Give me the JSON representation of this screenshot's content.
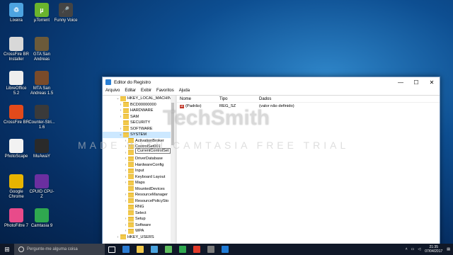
{
  "desktop": {
    "icons": [
      {
        "label": "Lixeira",
        "color": "#4da3e0",
        "glyph": "♲"
      },
      {
        "label": "µTorrent",
        "color": "#6ab42d",
        "glyph": "µ"
      },
      {
        "label": "Funny Voice",
        "color": "#444444",
        "glyph": "🎤"
      },
      {
        "label": "CrossFire BR Installer",
        "color": "#d8d8d8",
        "glyph": ""
      },
      {
        "label": "GTA San Andreas",
        "color": "#6b5a3a",
        "glyph": ""
      },
      {
        "label": "LibreOffice 5.2",
        "color": "#eeeeee",
        "glyph": ""
      },
      {
        "label": "MTA San Andreas 1.5",
        "color": "#7a4b2a",
        "glyph": ""
      },
      {
        "label": "CrossFire BR",
        "color": "#e34a1b",
        "glyph": ""
      },
      {
        "label": "Counter-Stri... 1.6",
        "color": "#3a3a3a",
        "glyph": ""
      },
      {
        "label": "PhotoScape",
        "color": "#f2f2f2",
        "glyph": ""
      },
      {
        "label": "MuAwaY",
        "color": "#2a2a2a",
        "glyph": ""
      },
      {
        "label": "Google Chrome",
        "color": "#e8b400",
        "glyph": ""
      },
      {
        "label": "CPUID CPU-Z",
        "color": "#6b2fa0",
        "glyph": ""
      },
      {
        "label": "PhotoFiltre 7",
        "color": "#e84b8a",
        "glyph": ""
      },
      {
        "label": "Camtasia 9",
        "color": "#2fa84f",
        "glyph": ""
      }
    ]
  },
  "window": {
    "title": "Editor do Registro",
    "controls": {
      "minimize": "—",
      "maximize": "☐",
      "close": "✕"
    },
    "menu": [
      "Arquivo",
      "Editar",
      "Exibir",
      "Favoritos",
      "Ajuda"
    ],
    "tree": {
      "root": "HKEY_LOCAL_MACHINE",
      "items": [
        {
          "label": "BCD00000000",
          "level": 1,
          "toggle": "›"
        },
        {
          "label": "HARDWARE",
          "level": 1,
          "toggle": "›"
        },
        {
          "label": "SAM",
          "level": 1,
          "toggle": "›"
        },
        {
          "label": "SECURITY",
          "level": 1,
          "toggle": ""
        },
        {
          "label": "SOFTWARE",
          "level": 1,
          "toggle": "›"
        },
        {
          "label": "SYSTEM",
          "level": 1,
          "toggle": "⌄",
          "selected": true
        },
        {
          "label": "ActivationBroker",
          "level": 2,
          "toggle": "›"
        },
        {
          "label": "ControlSet001",
          "level": 2,
          "toggle": "›"
        },
        {
          "label": "CurrentControlSet",
          "level": 2,
          "toggle": "›"
        },
        {
          "label": "DriverDatabase",
          "level": 2,
          "toggle": "›"
        },
        {
          "label": "HardwareConfig",
          "level": 2,
          "toggle": "›"
        },
        {
          "label": "Input",
          "level": 2,
          "toggle": "›"
        },
        {
          "label": "Keyboard Layout",
          "level": 2,
          "toggle": "›"
        },
        {
          "label": "Maps",
          "level": 2,
          "toggle": "›"
        },
        {
          "label": "MountedDevices",
          "level": 2,
          "toggle": ""
        },
        {
          "label": "ResourceManager",
          "level": 2,
          "toggle": "›"
        },
        {
          "label": "ResourcePolicySto",
          "level": 2,
          "toggle": "›"
        },
        {
          "label": "RNG",
          "level": 2,
          "toggle": ""
        },
        {
          "label": "Select",
          "level": 2,
          "toggle": ""
        },
        {
          "label": "Setup",
          "level": 2,
          "toggle": "›"
        },
        {
          "label": "Software",
          "level": 2,
          "toggle": "›"
        },
        {
          "label": "WPA",
          "level": 2,
          "toggle": "›"
        },
        {
          "label": "HKEY_USERS",
          "level": 0,
          "toggle": "›"
        }
      ],
      "tooltip": "CurrentControlSet"
    },
    "list": {
      "headers": [
        "Nome",
        "Tipo",
        "Dados"
      ],
      "rows": [
        {
          "name": "(Padrão)",
          "type": "REG_SZ",
          "data": "(valor não definido)",
          "icon": "ab"
        }
      ]
    }
  },
  "watermark": {
    "brand": "TechSmith",
    "text": "MADE WITH CAMTASIA FREE TRIAL"
  },
  "taskbar": {
    "search_placeholder": "Pergunte-me alguma coisa",
    "pinned": [
      {
        "name": "task-view",
        "color": "#ffffff"
      },
      {
        "name": "edge",
        "color": "#2b7cd3"
      },
      {
        "name": "explorer",
        "color": "#f2c94c"
      },
      {
        "name": "store",
        "color": "#4aa3df"
      },
      {
        "name": "media",
        "color": "#5fbf5f"
      },
      {
        "name": "camtasia",
        "color": "#2fa84f"
      },
      {
        "name": "camtasia-recorder",
        "color": "#e03a2a"
      },
      {
        "name": "app",
        "color": "#7a7a7a"
      },
      {
        "name": "regedit",
        "color": "#1f7bd6"
      }
    ],
    "time": "21:35",
    "date": "07/04/2017"
  }
}
